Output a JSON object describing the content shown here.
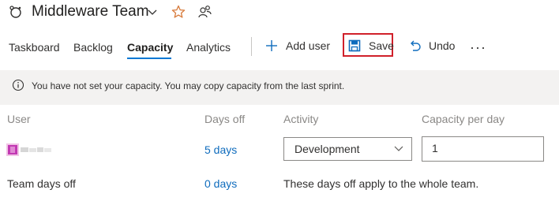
{
  "header": {
    "team_name": "Middleware Team",
    "icons": [
      "team-icon",
      "chevron-down-icon",
      "favorite-star-icon",
      "team-members-icon"
    ],
    "star_color": "#d77a3b"
  },
  "tabs": [
    {
      "label": "Taskboard",
      "active": false
    },
    {
      "label": "Backlog",
      "active": false
    },
    {
      "label": "Capacity",
      "active": true
    },
    {
      "label": "Analytics",
      "active": false
    }
  ],
  "commands": {
    "add_user": "Add user",
    "save": "Save",
    "undo": "Undo",
    "more": "···"
  },
  "banner": {
    "text": "You have not set your capacity. You may copy capacity from the last sprint."
  },
  "columns": [
    "User",
    "Days off",
    "Activity",
    "Capacity per day"
  ],
  "user_row": {
    "days_off": "5 days",
    "activity": "Development",
    "capacity": "1"
  },
  "team_row": {
    "label": "Team days off",
    "days_off": "0 days",
    "note": "These days off apply to the whole team."
  },
  "colors": {
    "accent": "#0078d4",
    "link": "#0f6cbd",
    "highlight": "#d0202a",
    "save_icon": "#0f6cbd"
  }
}
